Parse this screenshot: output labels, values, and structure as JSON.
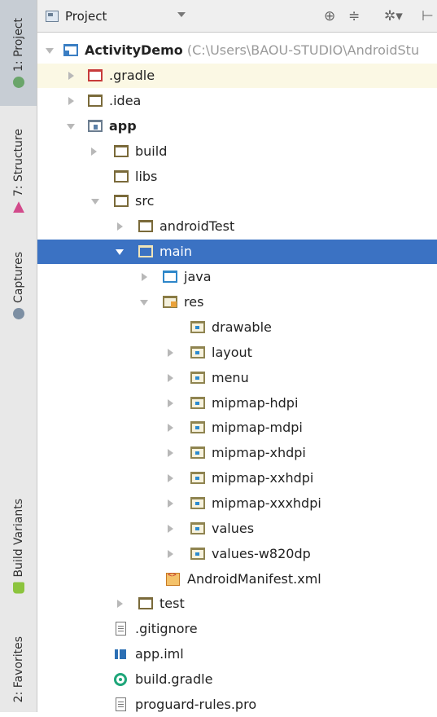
{
  "side_tabs": {
    "project": "1: Project",
    "structure": "7: Structure",
    "captures": "Captures",
    "build_variants": "Build Variants",
    "favorites": "2: Favorites"
  },
  "toolbar": {
    "view_selector": "Project",
    "icons": [
      "sync-icon",
      "collapse-icon",
      "settings-icon",
      "hide-icon"
    ]
  },
  "tree": {
    "root_name": "ActivityDemo",
    "root_path": "(C:\\Users\\BAOU-STUDIO\\AndroidStu",
    "items": [
      "ActivityDemo",
      ".gradle",
      ".idea",
      "app",
      "build",
      "libs",
      "src",
      "androidTest",
      "main",
      "java",
      "res",
      "drawable",
      "layout",
      "menu",
      "mipmap-hdpi",
      "mipmap-mdpi",
      "mipmap-xhdpi",
      "mipmap-xxhdpi",
      "mipmap-xxxhdpi",
      "values",
      "values-w820dp",
      "AndroidManifest.xml",
      "test",
      ".gitignore",
      "app.iml",
      "build.gradle",
      "proguard-rules.pro"
    ],
    "selected": "main"
  },
  "colors": {
    "selection": "#3b72c3",
    "highlight_row": "#fbf8e4",
    "path_gray": "#9a9a9a"
  }
}
